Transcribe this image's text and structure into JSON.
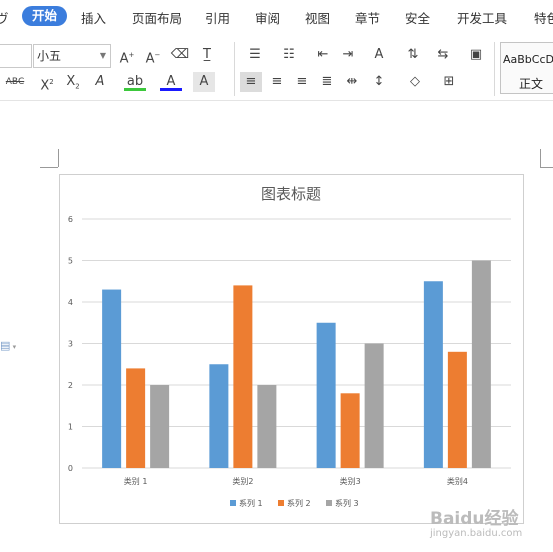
{
  "ribbon": {
    "tabs": [
      {
        "label": "ヴ"
      },
      {
        "label": "开始"
      },
      {
        "label": "插入"
      },
      {
        "label": "页面布局"
      },
      {
        "label": "引用"
      },
      {
        "label": "审阅"
      },
      {
        "label": "视图"
      },
      {
        "label": "章节"
      },
      {
        "label": "安全"
      },
      {
        "label": "开发工具"
      },
      {
        "label": "特色"
      }
    ],
    "font_size_value": "小五",
    "style_preview": "AaBbCcD",
    "style_name": "正文",
    "strike_label": "ABC"
  },
  "watermark": {
    "logo": "Baidu经验",
    "url": "jingyan.baidu.com"
  },
  "chart_data": {
    "type": "bar",
    "title": "图表标题",
    "categories": [
      "类别 1",
      "类别2",
      "类别3",
      "类别4"
    ],
    "series": [
      {
        "name": "系列 1",
        "values": [
          4.3,
          2.5,
          3.5,
          4.5
        ]
      },
      {
        "name": "系列 2",
        "values": [
          2.4,
          4.4,
          1.8,
          2.8
        ]
      },
      {
        "name": "系列 3",
        "values": [
          2.0,
          2.0,
          3.0,
          5.0
        ]
      }
    ],
    "ylim": [
      0,
      6
    ],
    "yticks": [
      "0",
      "1",
      "2",
      "3",
      "4",
      "5",
      "6"
    ],
    "colors": [
      "#5b9bd5",
      "#ed7d31",
      "#a5a5a5"
    ],
    "grid": true,
    "legend": "bottom"
  }
}
